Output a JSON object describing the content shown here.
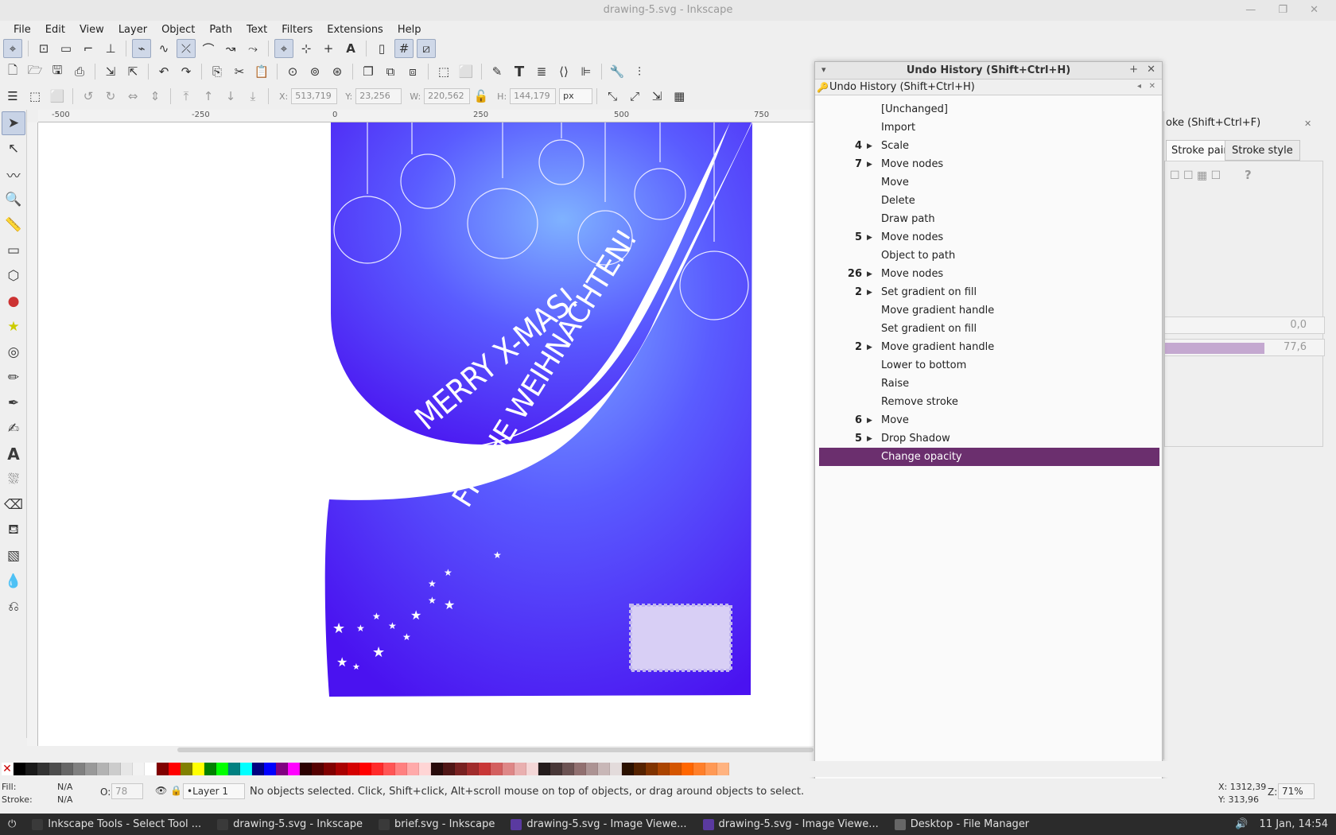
{
  "window": {
    "title": "drawing-5.svg - Inkscape",
    "controls": "—  ❐  ✕"
  },
  "menu": [
    "File",
    "Edit",
    "View",
    "Layer",
    "Object",
    "Path",
    "Text",
    "Filters",
    "Extensions",
    "Help"
  ],
  "controls": {
    "x_label": "X:",
    "x_value": "513,719",
    "y_label": "Y:",
    "y_value": "23,256",
    "w_label": "W:",
    "w_value": "220,562",
    "h_label": "H:",
    "h_value": "144,179",
    "unit": "px"
  },
  "ruler": {
    "h_ticks": [
      "-500",
      "-250",
      "0",
      "250",
      "500",
      "750"
    ]
  },
  "canvas": {
    "text1": "MERRY X-MAS!",
    "text2": "FROHE WEIHNACHTEN!"
  },
  "undo_dialog": {
    "title": "Undo History (Shift+Ctrl+H)",
    "subtitle": "Undo History (Shift+Ctrl+H)",
    "items": [
      {
        "count": "",
        "label": "[Unchanged]",
        "expandable": false
      },
      {
        "count": "",
        "label": "Import",
        "expandable": false
      },
      {
        "count": "4",
        "label": "Scale",
        "expandable": true
      },
      {
        "count": "7",
        "label": "Move nodes",
        "expandable": true
      },
      {
        "count": "",
        "label": "Move",
        "expandable": false
      },
      {
        "count": "",
        "label": "Delete",
        "expandable": false
      },
      {
        "count": "",
        "label": "Draw path",
        "expandable": false
      },
      {
        "count": "5",
        "label": "Move nodes",
        "expandable": true
      },
      {
        "count": "",
        "label": "Object to path",
        "expandable": false
      },
      {
        "count": "26",
        "label": "Move nodes",
        "expandable": true
      },
      {
        "count": "2",
        "label": "Set gradient on fill",
        "expandable": true
      },
      {
        "count": "",
        "label": "Move gradient handle",
        "expandable": false
      },
      {
        "count": "",
        "label": "Set gradient on fill",
        "expandable": false
      },
      {
        "count": "2",
        "label": "Move gradient handle",
        "expandable": true
      },
      {
        "count": "",
        "label": "Lower to bottom",
        "expandable": false
      },
      {
        "count": "",
        "label": "Raise",
        "expandable": false
      },
      {
        "count": "",
        "label": "Remove stroke",
        "expandable": false
      },
      {
        "count": "6",
        "label": "Move",
        "expandable": true
      },
      {
        "count": "5",
        "label": "Drop Shadow",
        "expandable": true
      },
      {
        "count": "",
        "label": "Change opacity",
        "expandable": false,
        "selected": true
      }
    ]
  },
  "fill_panel": {
    "title": "oke (Shift+Ctrl+F)",
    "tab_stroke_paint": "Stroke paint",
    "tab_stroke_style": "Stroke style",
    "blur_value": "0,0",
    "opacity_value": "77,6",
    "help": "?"
  },
  "status": {
    "fill_label": "Fill:",
    "fill_value": "N/A",
    "stroke_label": "Stroke:",
    "stroke_value": "N/A",
    "opacity_label": "O:",
    "opacity_value": "78",
    "layer": "•Layer 1",
    "message": "No objects selected. Click, Shift+click, Alt+scroll mouse on top of objects, or drag around objects to select.",
    "cursor_x": "X: 1312,39",
    "cursor_y": "Y: 313,96",
    "zoom_label": "Z:",
    "zoom": "71%"
  },
  "taskbar": {
    "items": [
      {
        "label": "Inkscape Tools - Select Tool ...",
        "color": "#3a3a3a"
      },
      {
        "label": "drawing-5.svg - Inkscape",
        "color": "#3a3a3a"
      },
      {
        "label": "brief.svg - Inkscape",
        "color": "#3a3a3a"
      },
      {
        "label": "drawing-5.svg - Image Viewe...",
        "color": "#5a3aa0"
      },
      {
        "label": "drawing-5.svg - Image Viewe...",
        "color": "#5a3aa0"
      },
      {
        "label": "Desktop - File Manager",
        "color": "#666"
      }
    ],
    "clock": "11 Jan, 14:54"
  },
  "palette_colors": [
    "#000000",
    "#1a1a1a",
    "#333333",
    "#4d4d4d",
    "#666666",
    "#808080",
    "#999999",
    "#b3b3b3",
    "#cccccc",
    "#e6e6e6",
    "#f2f2f2",
    "#ffffff",
    "#800000",
    "#ff0000",
    "#808000",
    "#ffff00",
    "#008000",
    "#00ff00",
    "#008080",
    "#00ffff",
    "#000080",
    "#0000ff",
    "#800080",
    "#ff00ff",
    "#2b0000",
    "#550000",
    "#800000",
    "#aa0000",
    "#d40000",
    "#ff0000",
    "#ff2a2a",
    "#ff5555",
    "#ff8080",
    "#ffaaaa",
    "#ffd5d5",
    "#280b0b",
    "#501616",
    "#782121",
    "#a02c2c",
    "#c83737",
    "#d35f5f",
    "#de8787",
    "#e9afaf",
    "#f4d7d7",
    "#241c1c",
    "#483737",
    "#6c5353",
    "#917070",
    "#ac9393",
    "#c8b7b7",
    "#e3dbdb",
    "#2b1100",
    "#552200",
    "#803300",
    "#aa4400",
    "#d45500",
    "#ff6600",
    "#ff7f2a",
    "#ff9955",
    "#ffb380"
  ]
}
